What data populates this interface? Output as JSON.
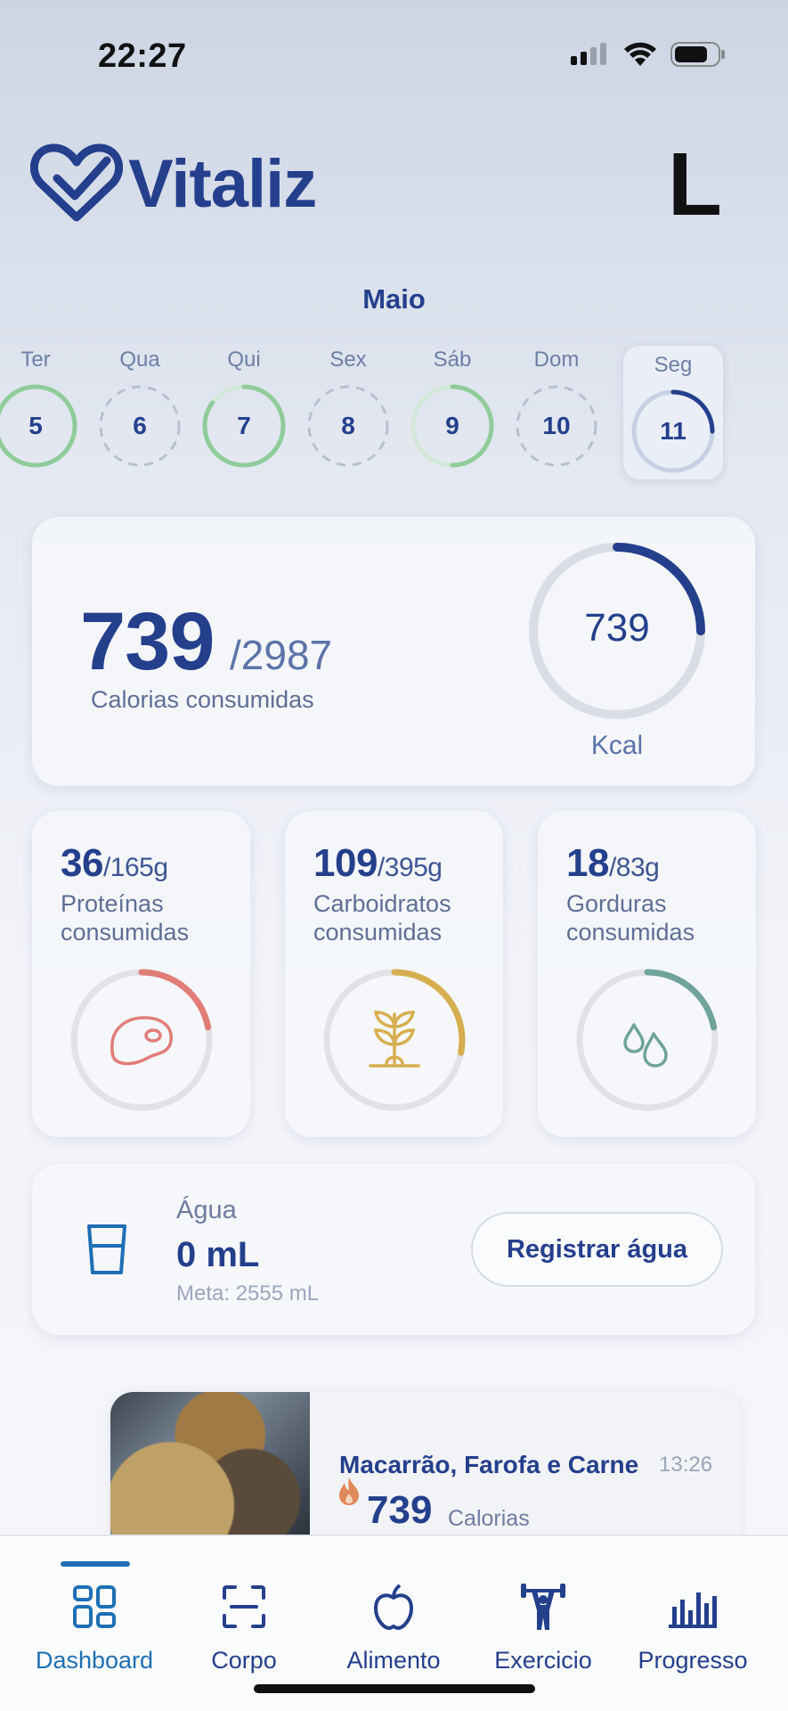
{
  "status_bar": {
    "time": "22:27"
  },
  "header": {
    "brand": "Vitaliz",
    "avatar_letter": "L"
  },
  "calendar": {
    "month": "Maio",
    "days": [
      {
        "name": "Ter",
        "num": "5",
        "progress": 1.0,
        "ring": "green"
      },
      {
        "name": "Qua",
        "num": "6",
        "progress": 0,
        "ring": "dashed"
      },
      {
        "name": "Qui",
        "num": "7",
        "progress": 0.85,
        "ring": "green"
      },
      {
        "name": "Sex",
        "num": "8",
        "progress": 0,
        "ring": "dashed"
      },
      {
        "name": "Sáb",
        "num": "9",
        "progress": 0.5,
        "ring": "green"
      },
      {
        "name": "Dom",
        "num": "10",
        "progress": 0,
        "ring": "dashed"
      },
      {
        "name": "Seg",
        "num": "11",
        "progress": 0.25,
        "ring": "blue",
        "selected": true
      }
    ]
  },
  "calories": {
    "consumed": "739",
    "goal": "/2987",
    "label": "Calorias consumidas",
    "ring_value": "739",
    "unit": "Kcal",
    "progress": 0.25
  },
  "macros": [
    {
      "key": "protein",
      "value": "36",
      "goal": "/165g",
      "line1": "Proteínas",
      "line2": "consumidas",
      "color": "#e07d78",
      "icon": "steak-icon",
      "progress": 0.22
    },
    {
      "key": "carbs",
      "value": "109",
      "goal": "/395g",
      "line1": "Carboidratos",
      "line2": "consumidas",
      "color": "#d6ae4f",
      "icon": "sprout-icon",
      "progress": 0.28
    },
    {
      "key": "fat",
      "value": "18",
      "goal": "/83g",
      "line1": "Gorduras",
      "line2": "consumidas",
      "color": "#6fa39c",
      "icon": "drops-icon",
      "progress": 0.22
    }
  ],
  "water": {
    "title": "Água",
    "value": "0 mL",
    "meta": "Meta: 2555 mL",
    "button": "Registrar água"
  },
  "meal": {
    "name": "Macarrão, Farofa e Carne",
    "time": "13:26",
    "calories": "739",
    "calories_label": "Calorias"
  },
  "tabs": [
    {
      "label": "Dashboard",
      "icon": "dashboard-icon",
      "active": true
    },
    {
      "label": "Corpo",
      "icon": "body-scan-icon"
    },
    {
      "label": "Alimento",
      "icon": "apple-icon"
    },
    {
      "label": "Exercicio",
      "icon": "weightlifter-icon"
    },
    {
      "label": "Progresso",
      "icon": "bar-chart-icon"
    }
  ],
  "colors": {
    "primary": "#243f8c",
    "accent_blue": "#1f6fb4",
    "green": "#8fcc9a"
  }
}
